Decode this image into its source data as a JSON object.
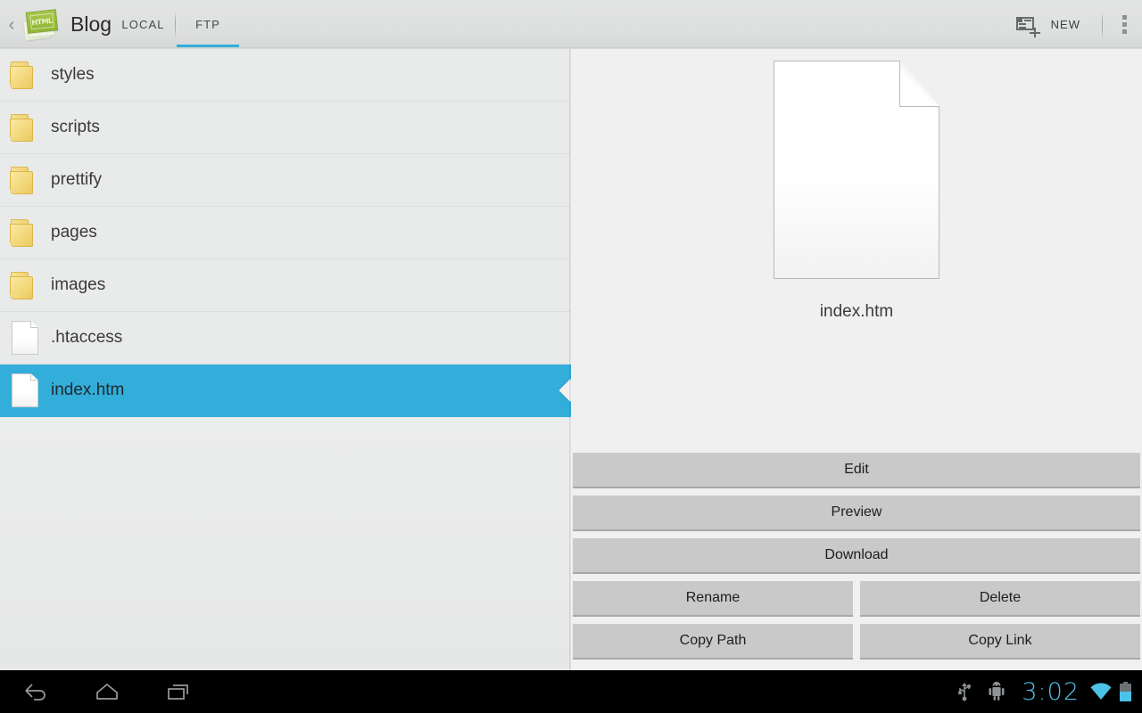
{
  "app": {
    "title": "Blog",
    "icon": "html-document-icon",
    "icon_glyph": "HTML",
    "back_icon": "back-chevron-icon"
  },
  "tabs": [
    {
      "id": "local",
      "label": "LOCAL",
      "active": false
    },
    {
      "id": "ftp",
      "label": "FTP",
      "active": true
    }
  ],
  "toolbar": {
    "new_label": "NEW",
    "new_icon": "new-document-icon",
    "overflow_icon": "overflow-menu-icon"
  },
  "file_list": [
    {
      "name": "styles",
      "type": "folder",
      "selected": false
    },
    {
      "name": "scripts",
      "type": "folder",
      "selected": false
    },
    {
      "name": "prettify",
      "type": "folder",
      "selected": false
    },
    {
      "name": "pages",
      "type": "folder",
      "selected": false
    },
    {
      "name": "images",
      "type": "folder",
      "selected": false
    },
    {
      "name": ".htaccess",
      "type": "file",
      "selected": false
    },
    {
      "name": "index.htm",
      "type": "file",
      "selected": true
    }
  ],
  "detail": {
    "filename": "index.htm",
    "preview_icon": "document-page-icon",
    "actions_full": [
      {
        "id": "edit",
        "label": "Edit"
      },
      {
        "id": "preview",
        "label": "Preview"
      },
      {
        "id": "download",
        "label": "Download"
      }
    ],
    "actions_paired": [
      {
        "id": "rename",
        "label": "Rename",
        "id2": "delete",
        "label2": "Delete"
      },
      {
        "id": "copy-path",
        "label": "Copy Path",
        "id2": "copy-link",
        "label2": "Copy Link"
      }
    ]
  },
  "system_bar": {
    "nav": [
      {
        "id": "back",
        "icon": "back-arrow-icon"
      },
      {
        "id": "home",
        "icon": "home-icon"
      },
      {
        "id": "recents",
        "icon": "recents-icon"
      }
    ],
    "status": {
      "usb_icon": "usb-icon",
      "android_icon": "android-robot-icon",
      "time": "3:02",
      "wifi_icon": "wifi-icon",
      "battery_icon": "battery-icon"
    }
  },
  "colors": {
    "accent_blue": "#33aedb",
    "status_cyan": "#4cc2e8",
    "list_bg": "#e9eaea",
    "panel_bg": "#f0f0f0",
    "button_gray": "#c9c9c9"
  }
}
